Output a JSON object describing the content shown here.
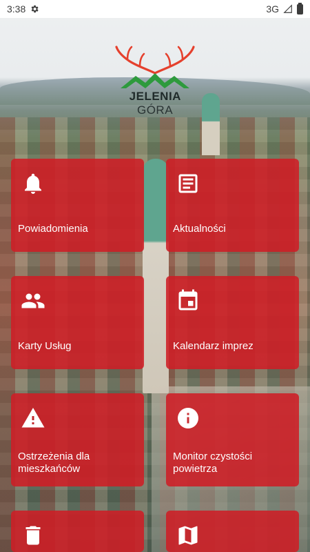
{
  "status_bar": {
    "time": "3:38",
    "network": "3G",
    "icons": [
      "gear-icon",
      "signal-icon",
      "battery-icon"
    ]
  },
  "logo": {
    "text_bold": "JELENIA",
    "text_light": "GÓRA",
    "colors": {
      "antlers": "#e5402d",
      "mountains": "#2e9a3d",
      "text": "#1f2a2a"
    }
  },
  "tiles": [
    {
      "label": "Powiadomienia",
      "icon": "bell-icon"
    },
    {
      "label": "Aktualności",
      "icon": "article-icon"
    },
    {
      "label": "Karty Usług",
      "icon": "people-icon"
    },
    {
      "label": "Kalendarz imprez",
      "icon": "calendar-icon"
    },
    {
      "label": "Ostrzeżenia dla mieszkańców",
      "icon": "warning-icon"
    },
    {
      "label": "Monitor czystości powietrza",
      "icon": "info-icon"
    },
    {
      "label": "",
      "icon": "trash-icon"
    },
    {
      "label": "",
      "icon": "map-icon"
    }
  ],
  "theme": {
    "tile_color": "#ce1e26",
    "tile_text": "#ffffff"
  }
}
